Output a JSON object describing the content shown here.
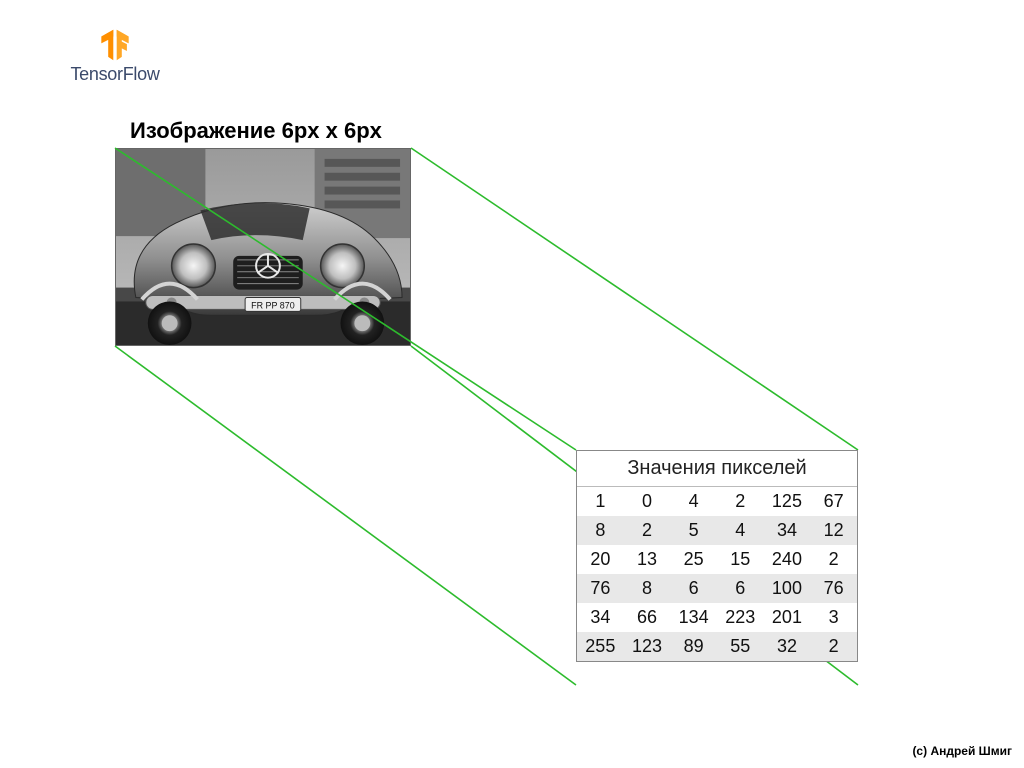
{
  "logo": {
    "text": "TensorFlow"
  },
  "image_title": "Изображение 6px x 6px",
  "license_plate": "FR PP 870",
  "table_header": "Значения пикселей",
  "chart_data": {
    "type": "table",
    "title": "Значения пикселей",
    "rows": 6,
    "cols": 6,
    "values": [
      [
        1,
        0,
        4,
        2,
        125,
        67
      ],
      [
        8,
        2,
        5,
        4,
        34,
        12
      ],
      [
        20,
        13,
        25,
        15,
        240,
        2
      ],
      [
        76,
        8,
        6,
        6,
        100,
        76
      ],
      [
        34,
        66,
        134,
        223,
        201,
        3
      ],
      [
        255,
        123,
        89,
        55,
        32,
        2
      ]
    ]
  },
  "credit": "(с) Андрей Шмиг"
}
